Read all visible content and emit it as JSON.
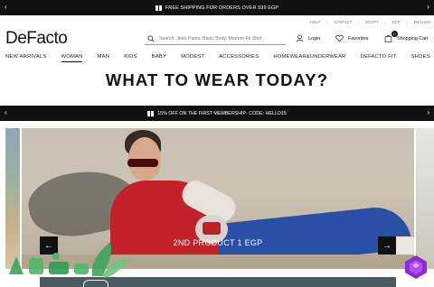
{
  "topbar": {
    "text": "FREE SHIPPING FOR ORDERS OVER 599 EGP",
    "prev_icon": "chevron-left-icon",
    "next_icon": "chevron-right-icon",
    "icon": "gift-icon"
  },
  "util_links": [
    "HELP",
    "CONTACT",
    "EGYPT",
    "EGP",
    "ENGLISH"
  ],
  "logo": "DeFacto",
  "search": {
    "placeholder": "Search: Jean Pants, Basic Body, Modern Fit Shirt"
  },
  "header_actions": {
    "login": "Login",
    "favorites": "Favorites",
    "cart": "Shopping Cart",
    "cart_count": "0"
  },
  "main_nav": [
    {
      "label": "NEW ARRIVALS",
      "active": false
    },
    {
      "label": "WOMAN",
      "active": true
    },
    {
      "label": "MAN",
      "active": false
    },
    {
      "label": "KIDS",
      "active": false
    },
    {
      "label": "BABY",
      "active": false
    },
    {
      "label": "MODEST",
      "active": false
    },
    {
      "label": "ACCESSORIES",
      "active": false
    },
    {
      "label": "HOMEWEAR&UNDERWEAR",
      "active": false
    },
    {
      "label": "DEFACTO FIT",
      "active": false
    },
    {
      "label": "SHOES",
      "active": false
    }
  ],
  "headline": "WHAT TO WEAR TODAY?",
  "promobar": {
    "text": "15% OFF ON THE FIRST MEMBERSHIP- CODE: HELLO15",
    "icon": "gift-icon"
  },
  "carousel": {
    "caption": "2ND PRODUCT 1 EGP",
    "prev_label": "←",
    "next_label": "→"
  },
  "colors": {
    "bar_bg": "#111111",
    "accent": "#c3222a"
  }
}
